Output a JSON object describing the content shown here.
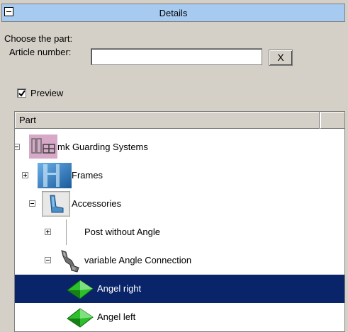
{
  "header": {
    "title": "Details"
  },
  "form": {
    "choose_label": "Choose the part:",
    "article_label": "Article number:",
    "article_value": "",
    "clear_button": "X",
    "preview_label": "Preview",
    "preview_checked": true
  },
  "tree": {
    "column_header": "Part",
    "items": [
      {
        "label": "mk Guarding Systems",
        "expanded": true,
        "icon": "guarding-system-icon"
      },
      {
        "label": "Frames",
        "expanded": false,
        "icon": "frames-icon"
      },
      {
        "label": "Accessories",
        "expanded": true,
        "icon": "accessories-icon"
      },
      {
        "label": "Post without Angle",
        "expanded": false,
        "icon": "none"
      },
      {
        "label": "variable Angle Connection",
        "expanded": true,
        "icon": "angle-connection-icon"
      },
      {
        "label": "Angel right",
        "selected": true,
        "icon": "green-part-icon"
      },
      {
        "label": "Angel left",
        "selected": false,
        "icon": "green-part-icon"
      }
    ]
  },
  "colors": {
    "header_bg": "#a6caf0",
    "selection": "#0a246a",
    "panel_bg": "#d4d0c8"
  }
}
